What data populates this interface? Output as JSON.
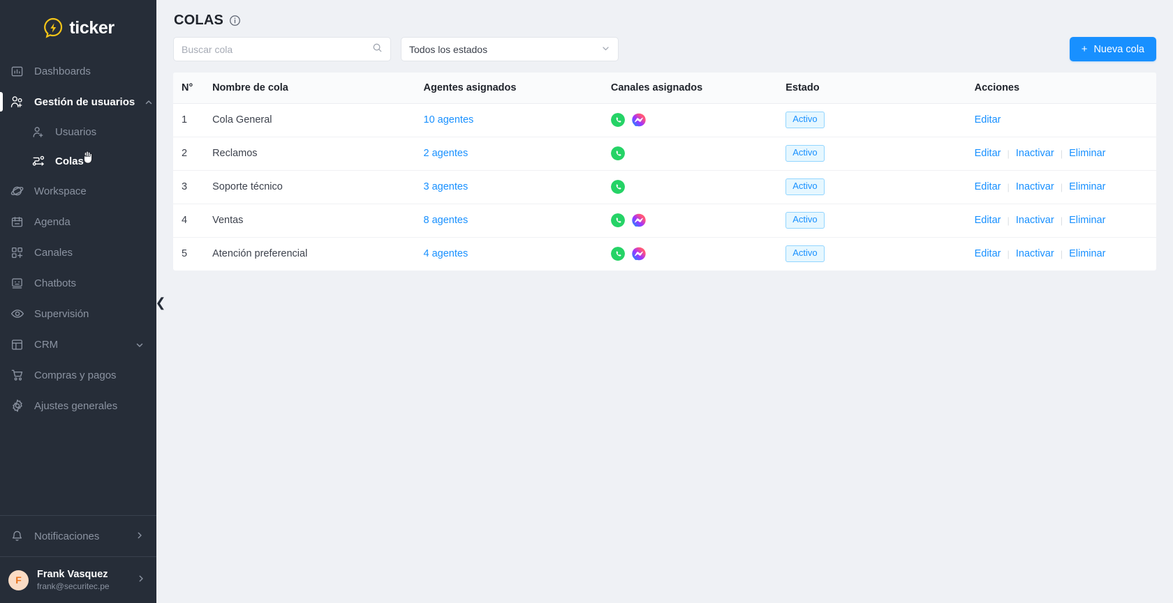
{
  "brand": {
    "word": "ticker",
    "logo_icon": "ticker-pin-icon",
    "accent": "#f5c518"
  },
  "sidebar": {
    "items": [
      {
        "label": "Dashboards",
        "icon": "dashboard-chart-icon",
        "state": "default"
      },
      {
        "label": "Gestión de usuarios",
        "icon": "users-add-icon",
        "state": "active",
        "caret": "chevron-up-icon"
      },
      {
        "label": "Usuarios",
        "icon": "user-add-icon",
        "state": "sub"
      },
      {
        "label": "Colas",
        "icon": "queue-flow-icon",
        "state": "sub-current"
      },
      {
        "label": "Workspace",
        "icon": "planet-icon",
        "state": "default"
      },
      {
        "label": "Agenda",
        "icon": "calendar-icon",
        "state": "default"
      },
      {
        "label": "Canales",
        "icon": "grid-add-icon",
        "state": "default"
      },
      {
        "label": "Chatbots",
        "icon": "robot-face-icon",
        "state": "default"
      },
      {
        "label": "Supervisión",
        "icon": "eye-icon",
        "state": "default"
      },
      {
        "label": "CRM",
        "icon": "layout-panels-icon",
        "state": "default",
        "caret": "chevron-down-icon"
      },
      {
        "label": "Compras y pagos",
        "icon": "shopping-cart-icon",
        "state": "default"
      },
      {
        "label": "Ajustes generales",
        "icon": "gear-icon",
        "state": "default"
      }
    ],
    "notifications": {
      "label": "Notificaciones",
      "icon": "bell-icon",
      "chevron": "chevron-right-icon"
    },
    "user": {
      "initial": "F",
      "name": "Frank Vasquez",
      "email": "frank@securitec.pe",
      "chevron": "chevron-right-icon"
    },
    "collapse_handle": {
      "icon": "chevron-left-icon",
      "glyph": "❮"
    }
  },
  "header": {
    "title": "COLAS",
    "info_icon": "info-circle-icon"
  },
  "toolbar": {
    "search_placeholder": "Buscar cola",
    "search_value": "",
    "search_icon": "search-icon",
    "status_filter_value": "Todos los estados",
    "status_filter_icon": "chevron-down-icon",
    "new_queue_label": "Nueva cola",
    "new_queue_icon": "plus-icon",
    "accent_color": "#1890ff"
  },
  "table": {
    "columns": [
      "N°",
      "Nombre de cola",
      "Agentes asignados",
      "Canales asignados",
      "Estado",
      "Acciones"
    ],
    "rows": [
      {
        "n": "1",
        "name": "Cola General",
        "agents": "10 agentes",
        "channels": [
          "whatsapp-icon",
          "messenger-icon"
        ],
        "status": "Activo",
        "actions": [
          "Editar"
        ]
      },
      {
        "n": "2",
        "name": "Reclamos",
        "agents": "2 agentes",
        "channels": [
          "whatsapp-icon"
        ],
        "status": "Activo",
        "actions": [
          "Editar",
          "Inactivar",
          "Eliminar"
        ]
      },
      {
        "n": "3",
        "name": "Soporte técnico",
        "agents": "3 agentes",
        "channels": [
          "whatsapp-icon"
        ],
        "status": "Activo",
        "actions": [
          "Editar",
          "Inactivar",
          "Eliminar"
        ]
      },
      {
        "n": "4",
        "name": "Ventas",
        "agents": "8 agentes",
        "channels": [
          "whatsapp-icon",
          "messenger-icon"
        ],
        "status": "Activo",
        "actions": [
          "Editar",
          "Inactivar",
          "Eliminar"
        ]
      },
      {
        "n": "5",
        "name": "Atención preferencial",
        "agents": "4 agentes",
        "channels": [
          "whatsapp-icon",
          "messenger-icon"
        ],
        "status": "Activo",
        "actions": [
          "Editar",
          "Inactivar",
          "Eliminar"
        ]
      }
    ]
  },
  "colors": {
    "sidebar_bg": "#262d38",
    "page_bg": "#eff1f5",
    "link": "#1890ff",
    "badge_bg": "#e6f7ff",
    "badge_border": "#91d5ff",
    "whatsapp": "#25d366",
    "messenger": "#a334fa"
  }
}
